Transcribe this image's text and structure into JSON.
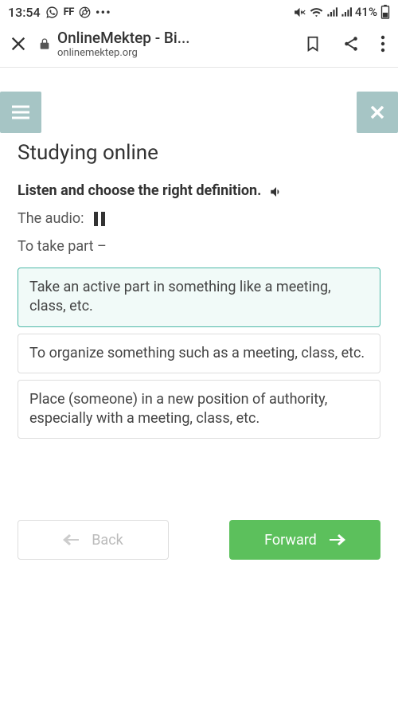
{
  "status": {
    "time": "13:54",
    "ff": "FF",
    "battery": "41%"
  },
  "browser": {
    "title": "OnlineMektep - Bi...",
    "domain": "onlinemektep.org"
  },
  "page": {
    "title": "Studying online",
    "instruction": "Listen and choose the right definition.",
    "audio_label": "The audio:",
    "prompt": "To take part –"
  },
  "options": [
    {
      "text": "Take an active part in something like a meeting, class, etc.",
      "selected": true
    },
    {
      "text": "To organize something such as a meeting, class, etc.",
      "selected": false
    },
    {
      "text": "Place (someone) in a new position of authority, especially with a meeting, class, etc.",
      "selected": false
    }
  ],
  "nav": {
    "back": "Back",
    "forward": "Forward"
  }
}
